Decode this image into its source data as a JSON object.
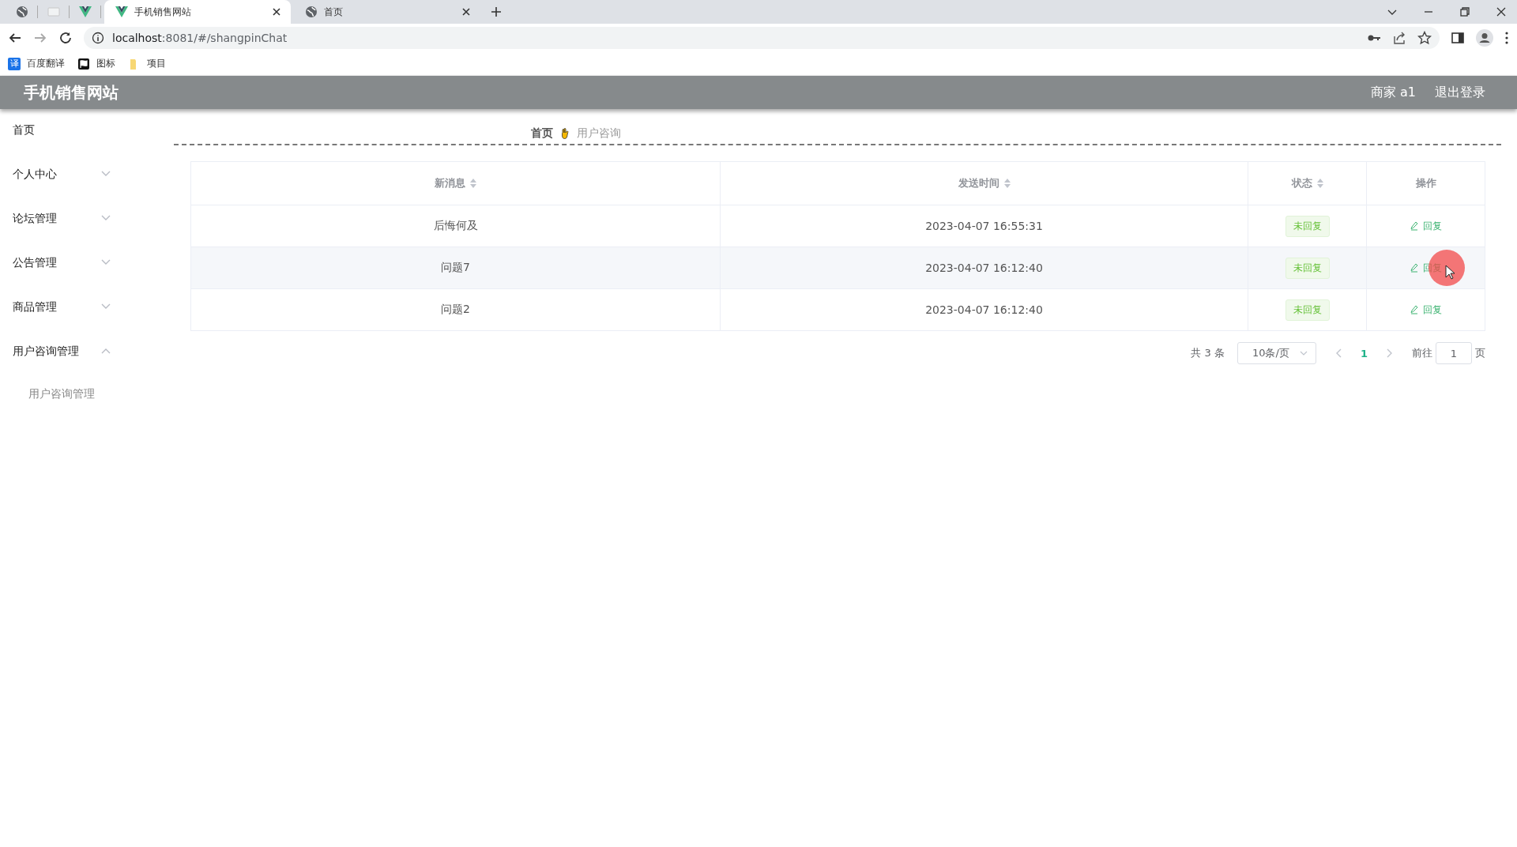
{
  "browser": {
    "tabs": [
      {
        "title": "手机销售网站",
        "selected": true
      },
      {
        "title": "首页",
        "selected": false
      }
    ],
    "url_host": "localhost",
    "url_rest": ":8081/#/shangpinChat",
    "bookmarks": [
      {
        "label": "百度翻译",
        "glyph": "译"
      },
      {
        "label": "图标"
      },
      {
        "label": "项目"
      }
    ]
  },
  "header": {
    "title": "手机销售网站",
    "user": "商家 a1",
    "logout": "退出登录"
  },
  "sidebar": {
    "items": [
      {
        "label": "首页",
        "kind": "link"
      },
      {
        "label": "个人中心",
        "kind": "group",
        "expanded": false
      },
      {
        "label": "论坛管理",
        "kind": "group",
        "expanded": false
      },
      {
        "label": "公告管理",
        "kind": "group",
        "expanded": false
      },
      {
        "label": "商品管理",
        "kind": "group",
        "expanded": false
      },
      {
        "label": "用户咨询管理",
        "kind": "group",
        "expanded": true,
        "children": [
          {
            "label": "用户咨询管理"
          }
        ]
      }
    ]
  },
  "breadcrumb": [
    {
      "label": "首页",
      "current": false
    },
    {
      "label": "用户咨询",
      "current": true
    }
  ],
  "table": {
    "columns": [
      {
        "label": "新消息",
        "sortable": true
      },
      {
        "label": "发送时间",
        "sortable": true
      },
      {
        "label": "状态",
        "sortable": true
      },
      {
        "label": "操作",
        "sortable": false
      }
    ],
    "rows": [
      {
        "message": "后悔何及",
        "time": "2023-04-07 16:55:31",
        "status": "未回复",
        "action": "回复",
        "hovered": false
      },
      {
        "message": "问题7",
        "time": "2023-04-07 16:12:40",
        "status": "未回复",
        "action": "回复",
        "hovered": true
      },
      {
        "message": "问题2",
        "time": "2023-04-07 16:12:40",
        "status": "未回复",
        "action": "回复",
        "hovered": false
      }
    ]
  },
  "pagination": {
    "total": "共 3 条",
    "page_size": "10条/页",
    "pages": [
      {
        "label": "1",
        "selected": true
      }
    ],
    "goto_label": "前往",
    "goto_value": "1",
    "goto_suffix": "页"
  }
}
